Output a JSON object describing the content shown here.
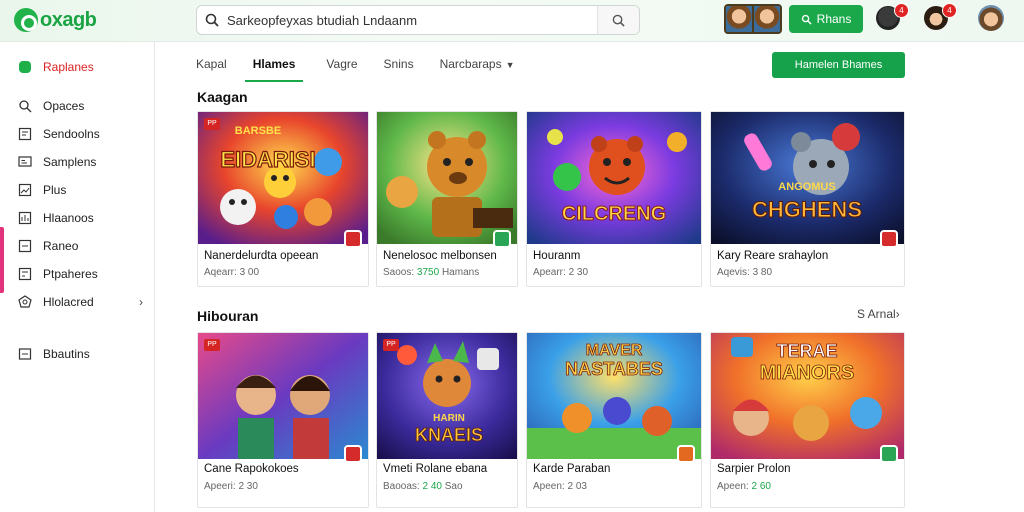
{
  "header": {
    "logo_text": "oxagb",
    "search_placeholder": "Sarkeopfeyxas btudiah Lndaanm",
    "primary_button": "Rhans",
    "badge_count_1": "4",
    "badge_count_2": "4"
  },
  "sidebar": {
    "items": [
      {
        "label": "Raplanes",
        "icon": "green-dot-icon",
        "active": true
      },
      {
        "label": "Opaces",
        "icon": "user-icon"
      },
      {
        "label": "Sendoolns",
        "icon": "book-icon"
      },
      {
        "label": "Samplens",
        "icon": "monitor-icon"
      },
      {
        "label": "Plus",
        "icon": "image-icon"
      },
      {
        "label": "Hlaanoos",
        "icon": "chart-icon"
      },
      {
        "label": "Raneo",
        "icon": "folder-icon"
      },
      {
        "label": "Ptpaheres",
        "icon": "grid-icon"
      },
      {
        "label": "Hlolacred",
        "icon": "globe-icon"
      },
      {
        "label": "Bbautins",
        "icon": "settings-icon"
      }
    ]
  },
  "tabs": [
    {
      "label": "Kapal"
    },
    {
      "label": "Hlames",
      "active": true
    },
    {
      "label": "Vagre"
    },
    {
      "label": "Snins"
    },
    {
      "label": "Narcbaraps"
    }
  ],
  "cta_label": "Hamelen Bhames",
  "sections": [
    {
      "title": "Kaagan",
      "see_all": "",
      "cards": [
        {
          "art_text": "EIDARISI",
          "art_top": "BARSBE",
          "tag": "PP",
          "title": "Nanerdelurdta opeean",
          "meta_prefix": "Aqearr: ",
          "meta_value": "3 00",
          "meta_color": "normal"
        },
        {
          "art_text": "",
          "art_top": "",
          "tag": "",
          "title": "Nenelosoc melbonsen",
          "meta_prefix": "Saoos: ",
          "meta_value": "3750",
          "meta_suffix": "Hamans",
          "meta_color": "green"
        },
        {
          "art_text": "CILCRENG",
          "art_top": "",
          "tag": "",
          "title": "Houranm",
          "meta_prefix": "Apearr: ",
          "meta_value": "2 30",
          "meta_color": "normal"
        },
        {
          "art_text": "CHGHENS",
          "art_top": "ANGOMUS",
          "tag": "",
          "title": "Kary Reare srahaylon",
          "meta_prefix": "Aqevis: ",
          "meta_value": "3 80",
          "meta_color": "normal"
        }
      ]
    },
    {
      "title": "Hibouran",
      "see_all": "S Arnal›",
      "cards": [
        {
          "art_text": "",
          "art_top": "",
          "tag": "PP",
          "title": "Cane Rapokokoes",
          "meta_prefix": "Apeeri: ",
          "meta_value": "2 30",
          "meta_color": "normal"
        },
        {
          "art_text": "KNAEIS",
          "art_top": "HARIN",
          "tag": "PP",
          "title": "Vmeti Rolane ebana",
          "meta_prefix": "Baooas: ",
          "meta_value": "2 40",
          "meta_suffix": "Sao",
          "meta_color": "green"
        },
        {
          "art_text": "NASTABES",
          "art_top": "MAVER",
          "tag": "",
          "title": "Karde Paraban",
          "meta_prefix": "Apeen: ",
          "meta_value": "2 03",
          "meta_color": "normal"
        },
        {
          "art_text": "MIANORS",
          "art_top": "TERAE",
          "tag": "",
          "title": "Sarpier Prolon",
          "meta_prefix": "Apeen: ",
          "meta_value": "2 60",
          "meta_color": "green"
        }
      ]
    }
  ],
  "colors": {
    "brand_green": "#1aa84a",
    "accent_pink": "#e0337c",
    "badge_red": "#e02424"
  }
}
